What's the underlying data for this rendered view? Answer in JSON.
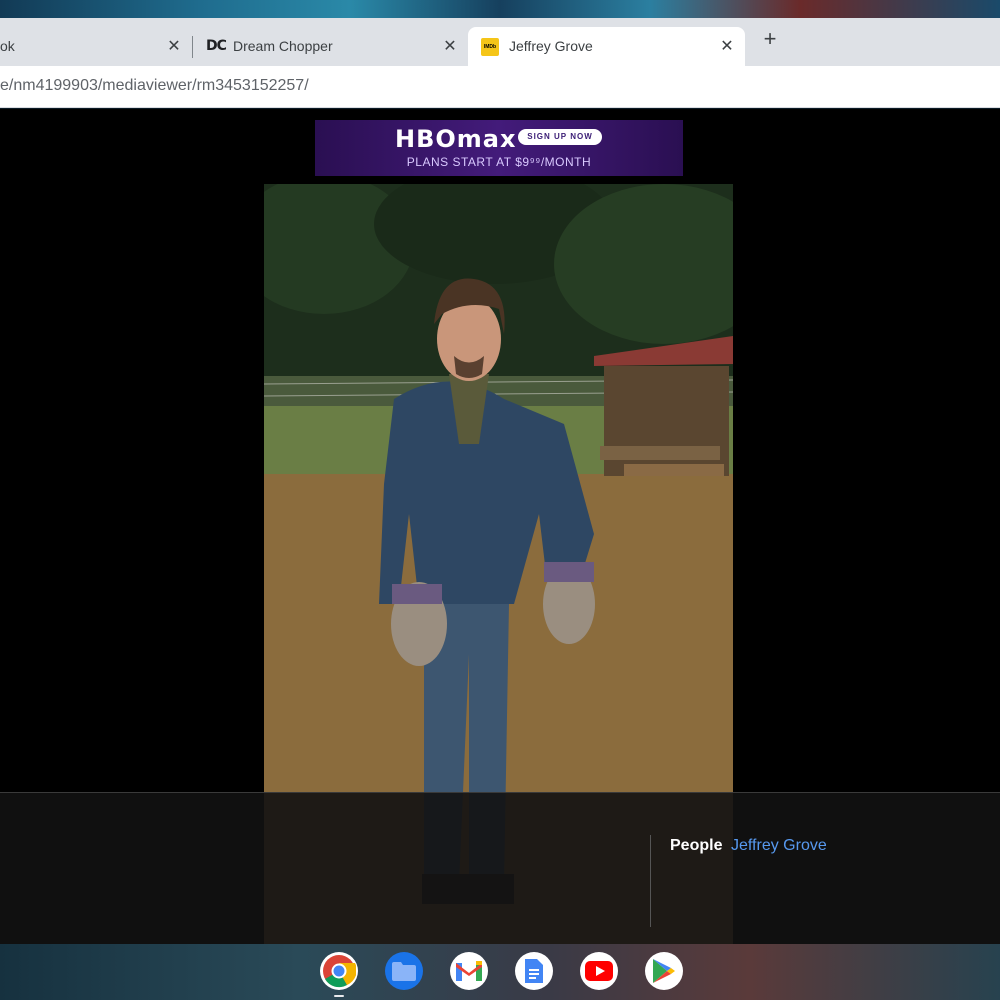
{
  "browser": {
    "tabs": [
      {
        "title": "ok",
        "close": "✕"
      },
      {
        "title": "Dream Chopper",
        "close": "✕",
        "favicon": "DC"
      },
      {
        "title": "Jeffrey Grove",
        "close": "✕",
        "favicon": "IMDb"
      }
    ],
    "new_tab": "+",
    "url": "e/nm4199903/mediaviewer/rm3453152257/"
  },
  "ad": {
    "logo": "HBOmax",
    "cta": "SIGN UP NOW",
    "tagline": "PLANS START AT $9⁹⁹/MONTH"
  },
  "info": {
    "people_label": "People",
    "people_name": "Jeffrey Grove"
  },
  "shelf": {
    "apps": [
      "chrome-icon",
      "files-icon",
      "gmail-icon",
      "docs-icon",
      "youtube-icon",
      "play-store-icon"
    ]
  }
}
